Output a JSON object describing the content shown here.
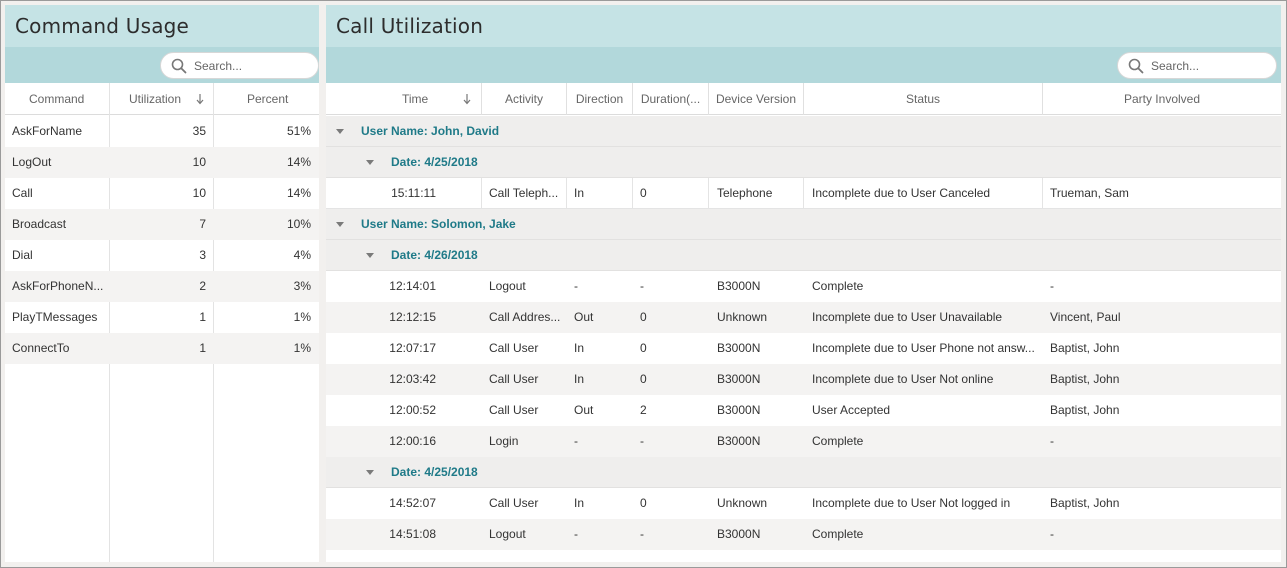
{
  "command_usage": {
    "title": "Command Usage",
    "search_placeholder": "Search...",
    "columns": {
      "command": "Command",
      "utilization": "Utilization",
      "percent": "Percent"
    },
    "rows": [
      {
        "command": "AskForName",
        "utilization": "35",
        "percent": "51%"
      },
      {
        "command": "LogOut",
        "utilization": "10",
        "percent": "14%"
      },
      {
        "command": "Call",
        "utilization": "10",
        "percent": "14%"
      },
      {
        "command": "Broadcast",
        "utilization": "7",
        "percent": "10%"
      },
      {
        "command": "Dial",
        "utilization": "3",
        "percent": "4%"
      },
      {
        "command": "AskForPhoneN...",
        "utilization": "2",
        "percent": "3%"
      },
      {
        "command": "PlayTMessages",
        "utilization": "1",
        "percent": "1%"
      },
      {
        "command": "ConnectTo",
        "utilization": "1",
        "percent": "1%"
      }
    ]
  },
  "call_utilization": {
    "title": "Call Utilization",
    "search_placeholder": "Search...",
    "columns": {
      "time": "Time",
      "activity": "Activity",
      "direction": "Direction",
      "duration": "Duration(...",
      "device_version": "Device Version",
      "status": "Status",
      "party": "Party Involved"
    },
    "groups": [
      {
        "user_label": "User Name: John, David",
        "dates": [
          {
            "date_label": "Date: 4/25/2018",
            "rows": [
              {
                "time": "15:11:11",
                "activity": "Call Teleph...",
                "direction": "In",
                "duration": "0",
                "device": "Telephone",
                "status": "Incomplete due to User Canceled",
                "party": "Trueman, Sam"
              }
            ]
          }
        ]
      },
      {
        "user_label": "User Name: Solomon, Jake",
        "dates": [
          {
            "date_label": "Date: 4/26/2018",
            "rows": [
              {
                "time": "12:14:01",
                "activity": "Logout",
                "direction": "-",
                "duration": "-",
                "device": "B3000N",
                "status": "Complete",
                "party": "-"
              },
              {
                "time": "12:12:15",
                "activity": "Call Addres...",
                "direction": "Out",
                "duration": "0",
                "device": "Unknown",
                "status": "Incomplete due to User Unavailable",
                "party": "Vincent, Paul"
              },
              {
                "time": "12:07:17",
                "activity": "Call User",
                "direction": "In",
                "duration": "0",
                "device": "B3000N",
                "status": "Incomplete due to User Phone not answ...",
                "party": "Baptist, John"
              },
              {
                "time": "12:03:42",
                "activity": "Call User",
                "direction": "In",
                "duration": "0",
                "device": "B3000N",
                "status": "Incomplete due to User Not online",
                "party": "Baptist, John"
              },
              {
                "time": "12:00:52",
                "activity": "Call User",
                "direction": "Out",
                "duration": "2",
                "device": "B3000N",
                "status": "User Accepted",
                "party": "Baptist, John"
              },
              {
                "time": "12:00:16",
                "activity": "Login",
                "direction": "-",
                "duration": "-",
                "device": "B3000N",
                "status": "Complete",
                "party": "-"
              }
            ]
          },
          {
            "date_label": "Date: 4/25/2018",
            "rows": [
              {
                "time": "14:52:07",
                "activity": "Call User",
                "direction": "In",
                "duration": "0",
                "device": "Unknown",
                "status": "Incomplete due to User Not logged in",
                "party": "Baptist, John"
              },
              {
                "time": "14:51:08",
                "activity": "Logout",
                "direction": "-",
                "duration": "-",
                "device": "B3000N",
                "status": "Complete",
                "party": "-"
              }
            ]
          }
        ]
      }
    ]
  },
  "colors": {
    "title_band": "#c5e3e5",
    "search_band": "#b2d8db",
    "group_text": "#1f7a88",
    "alt_row": "#f4f3f2"
  }
}
